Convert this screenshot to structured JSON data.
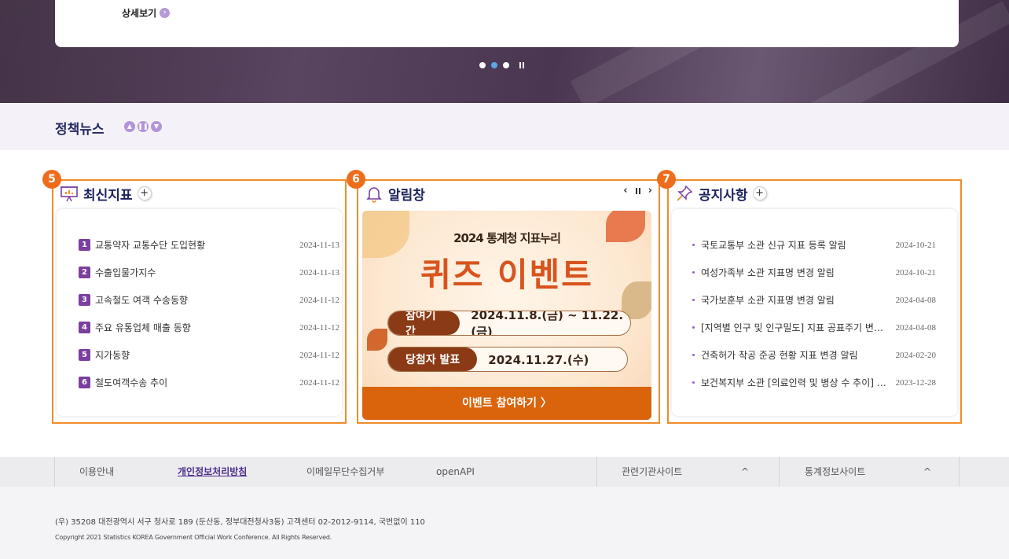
{
  "hero": {
    "more_label": "상세보기",
    "more_icon": "chevron-right-icon"
  },
  "policy_news": {
    "title": "정책뉴스"
  },
  "latest_indicators": {
    "badge": "5",
    "title": "최신지표",
    "plus": "+",
    "items": [
      {
        "no": "1",
        "title": "교통약자 교통수단 도입현황",
        "date": "2024-11-13"
      },
      {
        "no": "2",
        "title": "수출입물가지수",
        "date": "2024-11-13"
      },
      {
        "no": "3",
        "title": "고속철도 여객 수송동향",
        "date": "2024-11-12"
      },
      {
        "no": "4",
        "title": "주요 유통업체 매출 동향",
        "date": "2024-11-12"
      },
      {
        "no": "5",
        "title": "지가동향",
        "date": "2024-11-12"
      },
      {
        "no": "6",
        "title": "철도여객수송 추이",
        "date": "2024-11-12"
      }
    ]
  },
  "alert": {
    "badge": "6",
    "title": "알림창",
    "prev": "‹",
    "next": "›",
    "banner": {
      "subtitle": "2024 통계청 지표누리",
      "headline": "퀴즈 이벤트",
      "period_label": "참여기간",
      "period_value": "2024.11.8.(금) ~ 11.22.(금)",
      "winner_label": "당첨자 발표",
      "winner_value": "2024.11.27.(수)",
      "button_label": "이벤트 참여하기 〉"
    }
  },
  "notices": {
    "badge": "7",
    "title": "공지사항",
    "plus": "+",
    "items": [
      {
        "title": "국토교통부 소관 신규 지표 등록 알림",
        "date": "2024-10-21"
      },
      {
        "title": "여성가족부 소관 지표명 변경 알림",
        "date": "2024-10-21"
      },
      {
        "title": "국가보훈부 소관 지표명 변경 알림",
        "date": "2024-04-08"
      },
      {
        "title": "[지역별 인구 및 인구밀도] 지표 공표주기 변경 알림",
        "date": "2024-04-08"
      },
      {
        "title": "건축허가 착공 준공 현황 지표 변경 알림",
        "date": "2024-02-20"
      },
      {
        "title": "보건복지부 소관 [의료인력 및 병상 수 추이] 지표 변경 알림",
        "date": "2023-12-28"
      }
    ]
  },
  "footer": {
    "nav": [
      "이용안내",
      "개인정보처리방침",
      "이메일무단수집거부",
      "openAPI"
    ],
    "related": "관련기관사이트",
    "stats_sites": "통계정보사이트",
    "caret": "^",
    "address": "(우) 35208 대전광역시 서구 청사로 189 (둔산동, 정부대전청사3동) 고객센터 02-2012-9114, 국번없이 110",
    "copyright": "Copyright 2021 Statistics KOREA Government Official Work Conference. All Rights Reserved."
  },
  "colors": {
    "accent": "#f08c2a",
    "badge": "#ee6d1d",
    "number": "#7b3fa0",
    "title": "#1d2360"
  }
}
